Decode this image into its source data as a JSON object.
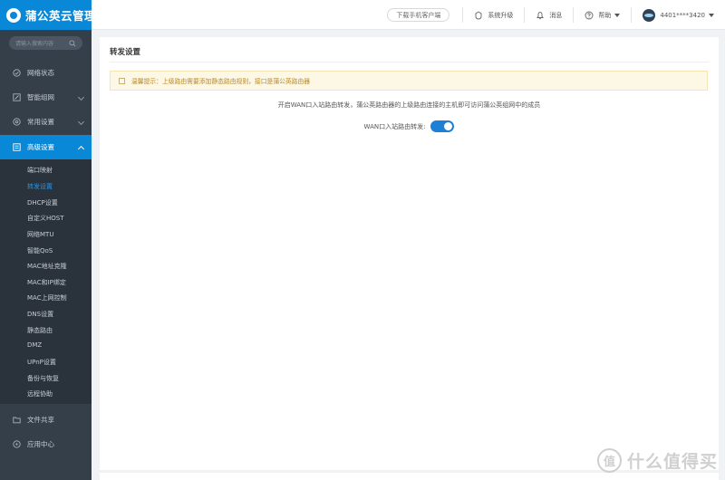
{
  "app": {
    "title": "蒲公英云管理"
  },
  "header": {
    "download_label": "下载手机客户端",
    "upgrade_label": "系统升级",
    "messages_label": "消息",
    "help_label": "帮助",
    "account_label": "4401****3420"
  },
  "sidebar": {
    "search_placeholder": "请输入搜索内容",
    "items": [
      {
        "label": "网络状态",
        "icon": "network-status-icon"
      },
      {
        "label": "智能组网",
        "icon": "smart-network-icon"
      },
      {
        "label": "常用设置",
        "icon": "settings-icon"
      },
      {
        "label": "高级设置",
        "icon": "advanced-settings-icon"
      },
      {
        "label": "文件共享",
        "icon": "file-share-icon"
      },
      {
        "label": "应用中心",
        "icon": "app-center-icon"
      }
    ],
    "submenu": [
      {
        "label": "端口映射"
      },
      {
        "label": "转发设置"
      },
      {
        "label": "DHCP设置"
      },
      {
        "label": "自定义HOST"
      },
      {
        "label": "网络MTU"
      },
      {
        "label": "智能QoS"
      },
      {
        "label": "MAC地址克隆"
      },
      {
        "label": "MAC和IP绑定"
      },
      {
        "label": "MAC上网控制"
      },
      {
        "label": "DNS设置"
      },
      {
        "label": "静态路由"
      },
      {
        "label": "DMZ"
      },
      {
        "label": "UPnP设置"
      },
      {
        "label": "备份与恢复"
      },
      {
        "label": "远程协助"
      }
    ]
  },
  "main": {
    "title": "转发设置",
    "tip": "温馨提示：上级路由需要添加静态路由规则，接口是蒲公英路由器",
    "description": "开启WAN口入站路由转发，蒲公英路由器的上级路由连接的主机即可访问蒲公英组网中的成员",
    "toggle_label": "WAN口入站路由转发:",
    "toggle_on": true
  },
  "watermark": {
    "seal": "值",
    "text": "什么值得买"
  },
  "colors": {
    "brand": "#0a88d8",
    "sidebar_bg": "#343f4a",
    "submenu_bg": "#2a333c",
    "toggle_on": "#1e7fd6",
    "tip_bg": "#fdf7e6"
  }
}
